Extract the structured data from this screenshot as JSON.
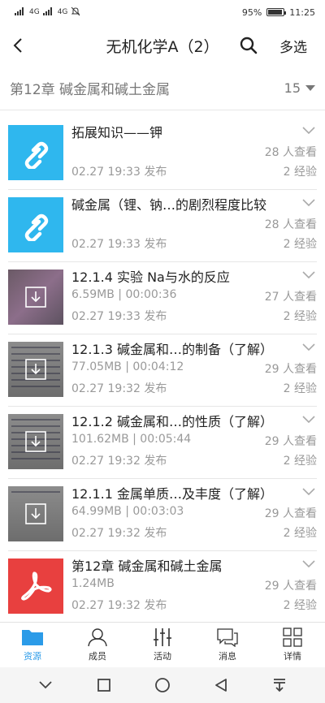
{
  "status": {
    "network_1": "4G",
    "network_2": "4G",
    "battery": "95%",
    "time": "11:25"
  },
  "header": {
    "title": "无机化学A（2）",
    "multi_select": "多选"
  },
  "chapter": {
    "title": "第12章 碱金属和碱土金属",
    "count": "15"
  },
  "items": [
    {
      "title": "拓展知识——钾",
      "meta_left": "",
      "views": "28 人查看",
      "date": "02.27 19:33 发布",
      "exp": "2 经验"
    },
    {
      "title": "碱金属（锂、钠…的剧烈程度比较",
      "meta_left": "",
      "views": "28 人查看",
      "date": "02.27 19:33 发布",
      "exp": "2 经验"
    },
    {
      "title": "12.1.4 实验 Na与水的反应",
      "meta_left": "6.59MB | 00:00:36",
      "views": "27 人查看",
      "date": "02.27 19:33 发布",
      "exp": "2 经验"
    },
    {
      "title": "12.1.3 碱金属和…的制备（了解）",
      "meta_left": "77.05MB | 00:04:12",
      "views": "29 人查看",
      "date": "02.27 19:32 发布",
      "exp": "2 经验"
    },
    {
      "title": "12.1.2 碱金属和…的性质（了解）",
      "meta_left": "101.62MB | 00:05:44",
      "views": "29 人查看",
      "date": "02.27 19:32 发布",
      "exp": "2 经验"
    },
    {
      "title": "12.1.1 金属单质…及丰度（了解）",
      "meta_left": "64.99MB | 00:03:03",
      "views": "29 人查看",
      "date": "02.27 19:32 发布",
      "exp": "2 经验"
    },
    {
      "title": "第12章 碱金属和碱土金属",
      "meta_left": "1.24MB",
      "views": "29 人查看",
      "date": "02.27 19:32 发布",
      "exp": "2 经验"
    }
  ],
  "tabs": [
    {
      "label": "资源"
    },
    {
      "label": "成员"
    },
    {
      "label": "活动"
    },
    {
      "label": "消息"
    },
    {
      "label": "详情"
    }
  ],
  "colors": {
    "accent": "#2b9be8",
    "link_thumb": "#2fb7ee",
    "pdf_thumb": "#e8403f"
  }
}
